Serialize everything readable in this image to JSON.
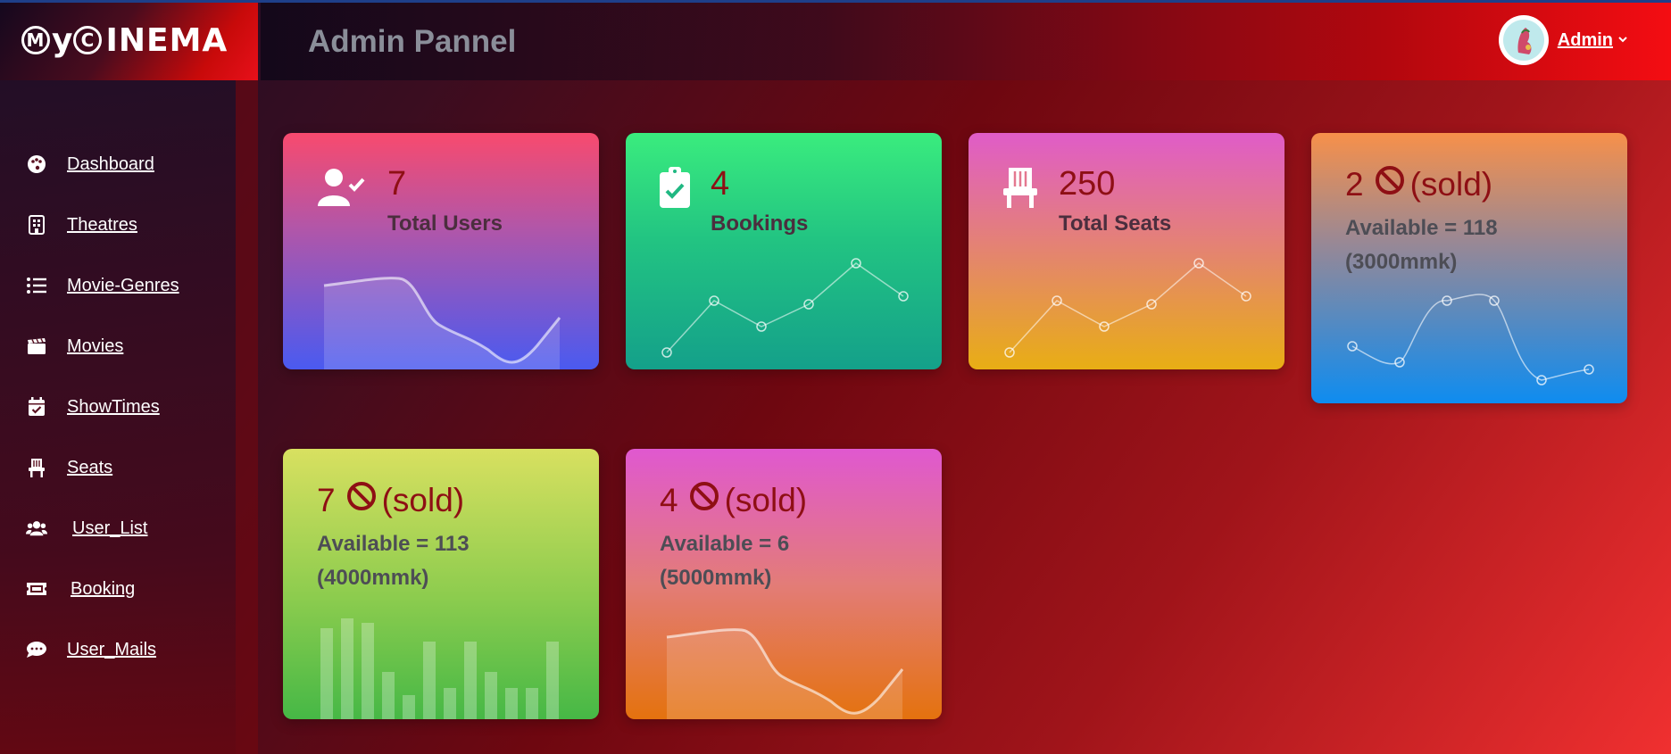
{
  "brand": {
    "prefix": "M",
    "y": "y",
    "c": "C",
    "rest": "INEMA"
  },
  "header": {
    "title": "Admin Pannel",
    "user": "Admin"
  },
  "sidebar": {
    "items": [
      {
        "label": "Dashboard",
        "icon": "palette-icon"
      },
      {
        "label": "Theatres",
        "icon": "building-icon"
      },
      {
        "label": "Movie-Genres",
        "icon": "list-icon"
      },
      {
        "label": "Movies",
        "icon": "clapperboard-icon"
      },
      {
        "label": "ShowTimes",
        "icon": "calendar-check-icon"
      },
      {
        "label": "Seats",
        "icon": "chair-icon"
      },
      {
        "label": "User_List",
        "icon": "users-icon"
      },
      {
        "label": "Booking",
        "icon": "ticket-icon"
      },
      {
        "label": "User_Mails",
        "icon": "comment-icon"
      }
    ]
  },
  "cards": {
    "users": {
      "value": "7",
      "label": "Total Users"
    },
    "bookings": {
      "value": "4",
      "label": "Bookings"
    },
    "seats": {
      "value": "250",
      "label": "Total Seats"
    },
    "price1": {
      "sold": "2",
      "sold_label": "(sold)",
      "available": "Available = 118",
      "price": "(3000mmk)"
    },
    "price2": {
      "sold": "7",
      "sold_label": "(sold)",
      "available": "Available = 113",
      "price": "(4000mmk)"
    },
    "price3": {
      "sold": "4",
      "sold_label": "(sold)",
      "available": "Available = 6",
      "price": "(5000mmk)"
    }
  },
  "colors": {
    "value_text": "#8e0f14",
    "card_users": [
      "#f84a6e",
      "#4a5af0"
    ],
    "card_bookings": [
      "#3aec7e",
      "#14a08a"
    ],
    "card_seats": [
      "#e05cc8",
      "#e8ae14"
    ],
    "card_price1": [
      "#f7904a",
      "#0e8cf0"
    ],
    "card_price2": [
      "#d8e060",
      "#46b846"
    ],
    "card_price3": [
      "#e058d0",
      "#e4720e"
    ]
  }
}
